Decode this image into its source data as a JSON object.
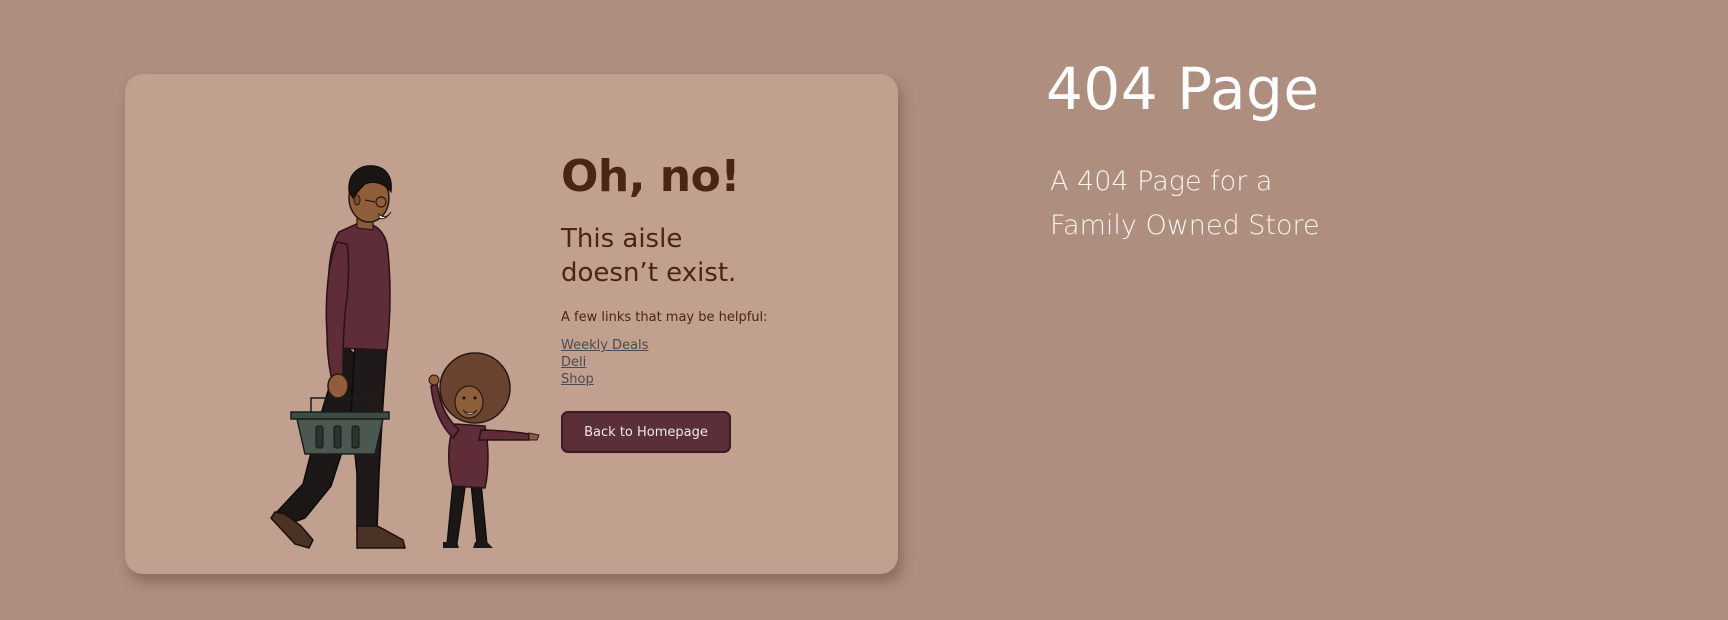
{
  "card": {
    "heading": "Oh, no!",
    "subheading": "This aisle doesn’t exist.",
    "helper_text": "A few links that may be helpful:",
    "links": [
      {
        "label": "Weekly Deals"
      },
      {
        "label": "Deli"
      },
      {
        "label": "Shop"
      }
    ],
    "home_button_label": "Back to Homepage"
  },
  "side": {
    "title": "404 Page",
    "description": "A 404 Page for a Family Owned Store"
  },
  "colors": {
    "page_background": "#ae8e7e",
    "card_background": "#c1a08f",
    "heading_text": "#4a2612",
    "button_background": "#5b2f38",
    "shirt": "#5e2d38"
  },
  "illustration": {
    "subjects": [
      "adult-with-shopping-basket",
      "child-pointing"
    ]
  }
}
